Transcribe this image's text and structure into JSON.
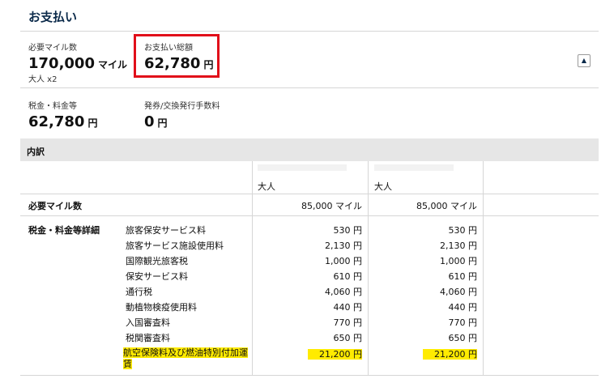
{
  "header": {
    "title": "お支払い"
  },
  "summary": {
    "required_miles_label": "必要マイル数",
    "required_miles_value": "170,000",
    "required_miles_unit": "マイル",
    "pax_note": "大人 x2",
    "total_label": "お支払い総額",
    "total_value": "62,780",
    "total_unit": "円",
    "tax_label": "税金・料金等",
    "tax_value": "62,780",
    "tax_unit": "円",
    "fee_label": "発券/交換発行手数料",
    "fee_value": "0",
    "fee_unit": "円",
    "toggle_symbol": "▲"
  },
  "breakdown": {
    "section_label": "内訳",
    "columns": [
      "大人",
      "大人"
    ],
    "miles_row": {
      "label": "必要マイル数",
      "values": [
        "85,000 マイル",
        "85,000 マイル"
      ]
    },
    "tax_group_label": "税金・料金等詳細",
    "tax_rows": [
      {
        "name": "旅客保安サービス料",
        "values": [
          "530 円",
          "530 円"
        ]
      },
      {
        "name": "旅客サービス施設使用料",
        "values": [
          "2,130 円",
          "2,130 円"
        ]
      },
      {
        "name": "国際観光旅客税",
        "values": [
          "1,000 円",
          "1,000 円"
        ]
      },
      {
        "name": "保安サービス料",
        "values": [
          "610 円",
          "610 円"
        ]
      },
      {
        "name": "通行税",
        "values": [
          "4,060 円",
          "4,060 円"
        ]
      },
      {
        "name": "動植物検疫使用料",
        "values": [
          "440 円",
          "440 円"
        ]
      },
      {
        "name": "入国審査料",
        "values": [
          "770 円",
          "770 円"
        ]
      },
      {
        "name": "税関審査料",
        "values": [
          "650 円",
          "650 円"
        ]
      },
      {
        "name": "航空保険料及び燃油特別付加運賃",
        "values": [
          "21,200 円",
          "21,200 円"
        ],
        "highlight": true
      }
    ],
    "highlight_color": "#ffeb00"
  }
}
